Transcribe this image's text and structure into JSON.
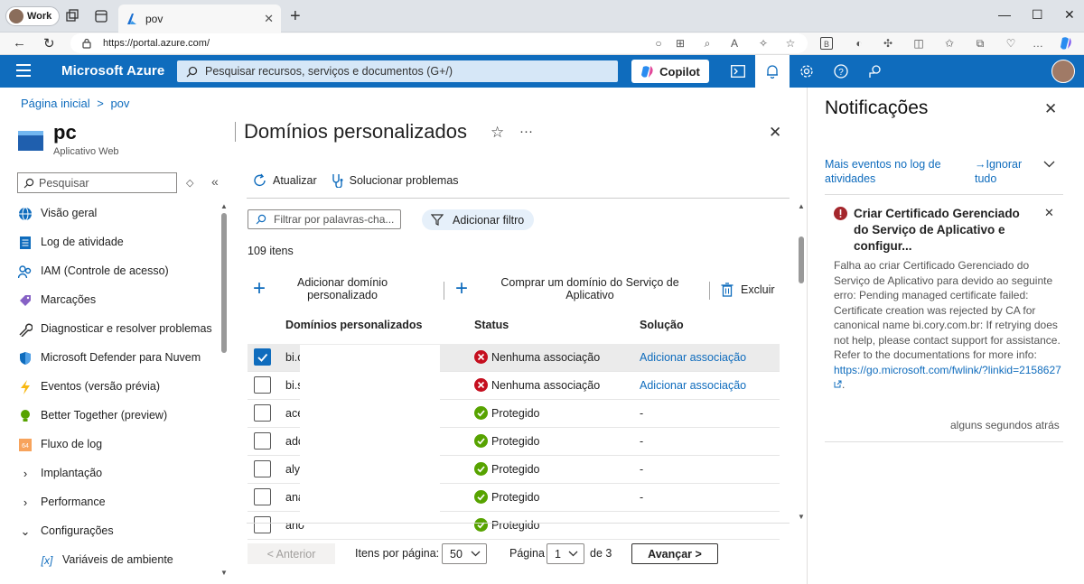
{
  "browser": {
    "profile_label": "Work",
    "tab_title": "pov",
    "url": "https://portal.azure.com/"
  },
  "azure": {
    "brand": "Microsoft Azure",
    "search_placeholder": "Pesquisar recursos, serviços e documentos (G+/)",
    "copilot_label": "Copilot"
  },
  "resource": {
    "breadcrumb_home": "Página inicial",
    "breadcrumb_sep": ">",
    "breadcrumb_current": "pov",
    "name": "pc",
    "type": "Aplicativo Web",
    "search_placeholder": "Pesquisar"
  },
  "nav": [
    {
      "label": "Visão geral",
      "icon": "globe-icon",
      "color": "#0f6cbd"
    },
    {
      "label": "Log de atividade",
      "icon": "activity-log-icon",
      "color": "#0f6cbd"
    },
    {
      "label": "IAM (Controle de acesso)",
      "icon": "people-icon",
      "color": "#0f6cbd"
    },
    {
      "label": "Marcações",
      "icon": "tag-icon",
      "color": "#8661c5"
    },
    {
      "label": "Diagnosticar e resolver problemas",
      "icon": "wrench-icon",
      "color": "#323130"
    },
    {
      "label": "Microsoft Defender para Nuvem",
      "icon": "shield-icon",
      "color": "#0f6cbd"
    },
    {
      "label": "Eventos (versão prévia)",
      "icon": "lightning-icon",
      "color": "#f8b811"
    },
    {
      "label": "Better Together (preview)",
      "icon": "lightbulb-icon",
      "color": "#57a300"
    },
    {
      "label": "Fluxo de log",
      "icon": "log-stream-icon",
      "color": "#f7a35c"
    },
    {
      "label": "Implantação",
      "icon": "chevron-right-icon",
      "color": "#323130"
    },
    {
      "label": "Performance",
      "icon": "chevron-right-icon",
      "color": "#323130"
    },
    {
      "label": "Configurações",
      "icon": "chevron-down-icon",
      "color": "#323130"
    },
    {
      "label": "Variáveis de ambiente",
      "icon": "variable-icon",
      "color": "#0f6cbd"
    }
  ],
  "page": {
    "title": "Domínios personalizados",
    "refresh": "Atualizar",
    "troubleshoot": "Solucionar problemas",
    "filter_placeholder": "Filtrar por palavras-cha...",
    "add_filter": "Adicionar filtro",
    "count": "109 itens",
    "add_custom_domain": "Adicionar domínio personalizado",
    "buy_domain": "Comprar um domínio do Serviço de Aplicativo",
    "delete": "Excluir"
  },
  "table": {
    "columns": [
      "Domínios personalizados",
      "Status",
      "Solução"
    ],
    "rows": [
      {
        "domain": "bi.c",
        "status": "Nenhuma associação",
        "status_kind": "error",
        "solution": "Adicionar associação",
        "selected": true
      },
      {
        "domain": "bi.s",
        "status": "Nenhuma associação",
        "status_kind": "error",
        "solution": "Adicionar associação",
        "selected": false
      },
      {
        "domain": "ace",
        "status": "Protegido",
        "status_kind": "ok",
        "solution": "-",
        "selected": false
      },
      {
        "domain": "adc",
        "status": "Protegido",
        "status_kind": "ok",
        "solution": "-",
        "selected": false
      },
      {
        "domain": "aly",
        "status": "Protegido",
        "status_kind": "ok",
        "solution": "-",
        "selected": false
      },
      {
        "domain": "ana",
        "status": "Protegido",
        "status_kind": "ok",
        "solution": "-",
        "selected": false
      },
      {
        "domain": "ano",
        "status": "Protegido",
        "status_kind": "ok",
        "solution": "",
        "selected": false
      }
    ]
  },
  "pager": {
    "previous": "< Anterior",
    "per_page_label": "Itens por página:",
    "per_page": "50",
    "page_label": "Página",
    "page": "1",
    "of": "de 3",
    "next": "Avançar >"
  },
  "notifications": {
    "title": "Notificações",
    "more_events": "Mais eventos no log de atividades",
    "ignore_all": "→Ignorar tudo",
    "item_title": "Criar Certificado Gerenciado do Serviço de Aplicativo e configur...",
    "item_body": "Falha ao criar Certificado Gerenciado do Serviço de Aplicativo para devido ao seguinte erro: Pending managed certificate failed: Certificate creation was rejected by CA for canonical name bi.cory.com.br: If retrying does not help, please contact support for assistance. Refer to the documentations for more info:",
    "item_link": "https://go.microsoft.com/fwlink/?linkid=2158627",
    "item_link_suffix": ".",
    "item_time": "alguns segundos atrás"
  },
  "colors": {
    "azure_blue": "#0f6cbd",
    "error_red": "#c50f1f",
    "success_green": "#57a300"
  }
}
